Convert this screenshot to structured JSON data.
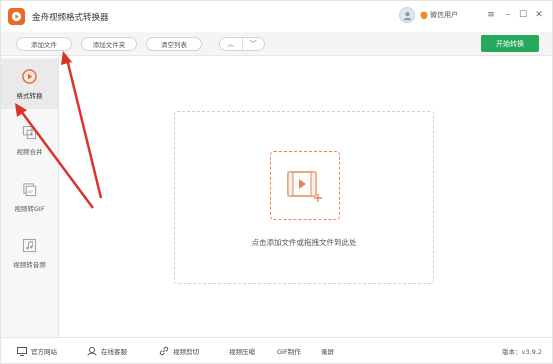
{
  "app": {
    "title": "金舟视频格式转换器"
  },
  "user": {
    "name": "微信用户"
  },
  "window_controls": {
    "menu": "≡",
    "minimize": "─",
    "maximize": "☐",
    "close": "✕"
  },
  "toolbar": {
    "add_file": "添加文件",
    "add_folder": "添加文件夹",
    "clear_list": "清空列表",
    "up_arrow": "︿",
    "down_arrow": "﹀",
    "start": "开始转换"
  },
  "sidebar": {
    "items": [
      {
        "label": "格式转换",
        "icon": "play-circle-icon",
        "active": true
      },
      {
        "label": "视频合并",
        "icon": "merge-icon",
        "active": false
      },
      {
        "label": "视频转GIF",
        "icon": "gif-icon",
        "active": false
      },
      {
        "label": "视频转音频",
        "icon": "music-icon",
        "active": false
      }
    ]
  },
  "main": {
    "drop_hint": "点击添加文件或拖拽文件到此处"
  },
  "bottom": {
    "items": [
      "官方网站",
      "在线客服",
      "视频剪切",
      "视频压缩",
      "GIF制作",
      "录屏"
    ],
    "version": "版本：v3.9.2"
  },
  "colors": {
    "accent": "#e86a27",
    "start": "#27a85c",
    "annotation": "#d9342b"
  }
}
